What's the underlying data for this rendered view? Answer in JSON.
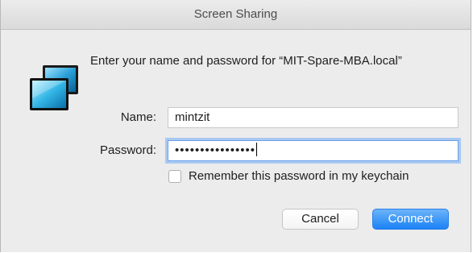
{
  "window": {
    "title": "Screen Sharing"
  },
  "dialog": {
    "prompt": "Enter your name and password for “MIT-Spare-MBA.local”",
    "app_icon": "screen-sharing-icon",
    "name_label": "Name:",
    "name_value": "mintzit",
    "password_label": "Password:",
    "password_masked": "••••••••••••••••",
    "remember_label": "Remember this password in my keychain",
    "remember_checked": false,
    "cancel_label": "Cancel",
    "connect_label": "Connect"
  },
  "colors": {
    "accent": "#1b82f5",
    "focus_ring": "#a8c9f3",
    "window_bg": "#ececec"
  }
}
